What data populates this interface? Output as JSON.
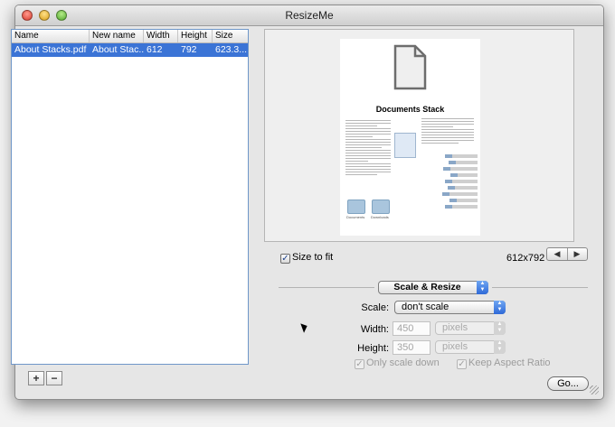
{
  "window": {
    "title": "ResizeMe"
  },
  "table": {
    "columns": [
      "Name",
      "New name",
      "Width",
      "Height",
      "Size"
    ],
    "rows": [
      {
        "name": "About Stacks.pdf",
        "new_name": "About Stac...",
        "width": "612",
        "height": "792",
        "size": "623.3..."
      }
    ]
  },
  "list_buttons": {
    "add": "+",
    "remove": "−"
  },
  "preview": {
    "doc_title": "Documents Stack",
    "size_to_fit_label": "Size to fit",
    "size_to_fit_checked": true,
    "dimensions": "612x792",
    "prev_label": "◀",
    "next_label": "▶",
    "folder_labels": [
      "Documents",
      "Downloads"
    ]
  },
  "mode_popup": {
    "value": "Scale & Resize"
  },
  "scale": {
    "label": "Scale:",
    "value": "don't scale"
  },
  "width": {
    "label": "Width:",
    "value": "450",
    "unit": "pixels"
  },
  "height": {
    "label": "Height:",
    "value": "350",
    "unit": "pixels"
  },
  "options": {
    "only_scale_down": {
      "label": "Only scale down",
      "checked": true,
      "enabled": false
    },
    "keep_aspect": {
      "label": "Keep Aspect Ratio",
      "checked": true,
      "enabled": false
    }
  },
  "go_button": {
    "label": "Go..."
  },
  "colors": {
    "selection": "#3b74d6",
    "accent": "#2f6ad8"
  }
}
